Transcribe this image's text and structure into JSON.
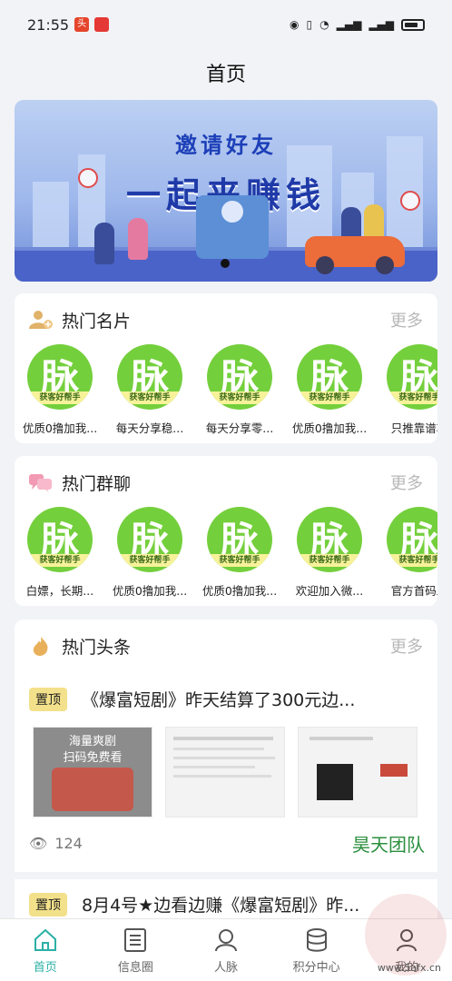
{
  "status_bar": {
    "time": "21:55",
    "badge": "头"
  },
  "page_title": "首页",
  "banner": {
    "line1": "邀请好友",
    "line2": "一起来赚钱",
    "coin_symbol": "¥"
  },
  "hot_cards": {
    "title": "热门名片",
    "more": "更多",
    "avatar_char": "脉",
    "avatar_band": "获客好帮手",
    "items": [
      "优质0撸加我...",
      "每天分享稳...",
      "每天分享零...",
      "优质0撸加我...",
      "只推靠谱项"
    ]
  },
  "hot_groups": {
    "title": "热门群聊",
    "more": "更多",
    "avatar_char": "脉",
    "avatar_band": "获客好帮手",
    "items": [
      "白嫖，长期...",
      "优质0撸加我...",
      "优质0撸加我...",
      "欢迎加入微...",
      "官方首码发"
    ]
  },
  "headlines": {
    "title": "热门头条",
    "more": "更多",
    "items": [
      {
        "pin": "置顶",
        "title": "《爆富短剧》昨天结算了300元边...",
        "poster_line1": "海量爽剧",
        "poster_line2": "扫码免费看",
        "views": "124",
        "team": "昊天团队"
      },
      {
        "pin": "置顶",
        "title": "8月4号★边看边赚《爆富短剧》昨..."
      }
    ]
  },
  "tabbar": {
    "items": [
      {
        "label": "首页",
        "icon": "home-icon"
      },
      {
        "label": "信息圈",
        "icon": "list-icon"
      },
      {
        "label": "人脉",
        "icon": "contacts-icon"
      },
      {
        "label": "积分中心",
        "icon": "points-icon"
      },
      {
        "label": "我的",
        "icon": "profile-icon"
      }
    ],
    "active": "首页"
  },
  "watermark": "www.5afx.cn",
  "colors": {
    "accent": "#2bb0a6",
    "avatar_green": "#74cf3c",
    "team_green": "#2b8f3e",
    "pin_yellow": "#f3e08a"
  }
}
